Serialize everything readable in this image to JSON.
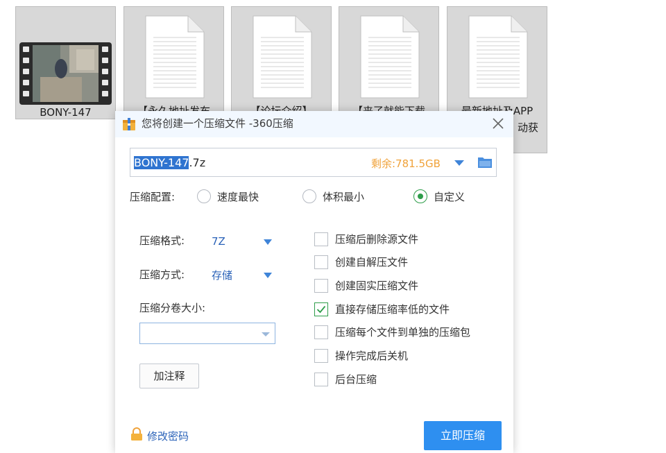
{
  "desktop": {
    "files": [
      {
        "name": "BONY-147",
        "type": "video"
      },
      {
        "name": "【永久地址发布",
        "type": "document"
      },
      {
        "name": "【论坛介绍】",
        "type": "document"
      },
      {
        "name": "【来了就能下载",
        "type": "document"
      },
      {
        "name": "最新地址及APP",
        "name_line2": "动获",
        "type": "document"
      }
    ]
  },
  "dialog": {
    "title": "您将创建一个压缩文件 -360压缩",
    "filename_selected": "BONY-147",
    "filename_ext": ".7z",
    "free_space": "剩余:781.5GB",
    "preset_label": "压缩配置:",
    "presets": [
      {
        "label": "速度最快",
        "checked": false
      },
      {
        "label": "体积最小",
        "checked": false
      },
      {
        "label": "自定义",
        "checked": true
      }
    ],
    "format_label": "压缩格式:",
    "format_value": "7Z",
    "method_label": "压缩方式:",
    "method_value": "存储",
    "volume_label": "压缩分卷大小:",
    "volume_value": "",
    "comment_button": "加注释",
    "options": [
      {
        "label": "压缩后删除源文件",
        "checked": false
      },
      {
        "label": "创建自解压文件",
        "checked": false
      },
      {
        "label": "创建固实压缩文件",
        "checked": false
      },
      {
        "label": "直接存储压缩率低的文件",
        "checked": true
      },
      {
        "label": "压缩每个文件到单独的压缩包",
        "checked": false
      },
      {
        "label": "操作完成后关机",
        "checked": false
      },
      {
        "label": "后台压缩",
        "checked": false
      }
    ],
    "change_password": "修改密码",
    "compress_button": "立即压缩",
    "colors": {
      "accent": "#2e8ff0",
      "check": "#2e9d4a",
      "link": "#2a62b8",
      "free_space": "#f0a23a",
      "selection": "#2f74d0"
    }
  }
}
